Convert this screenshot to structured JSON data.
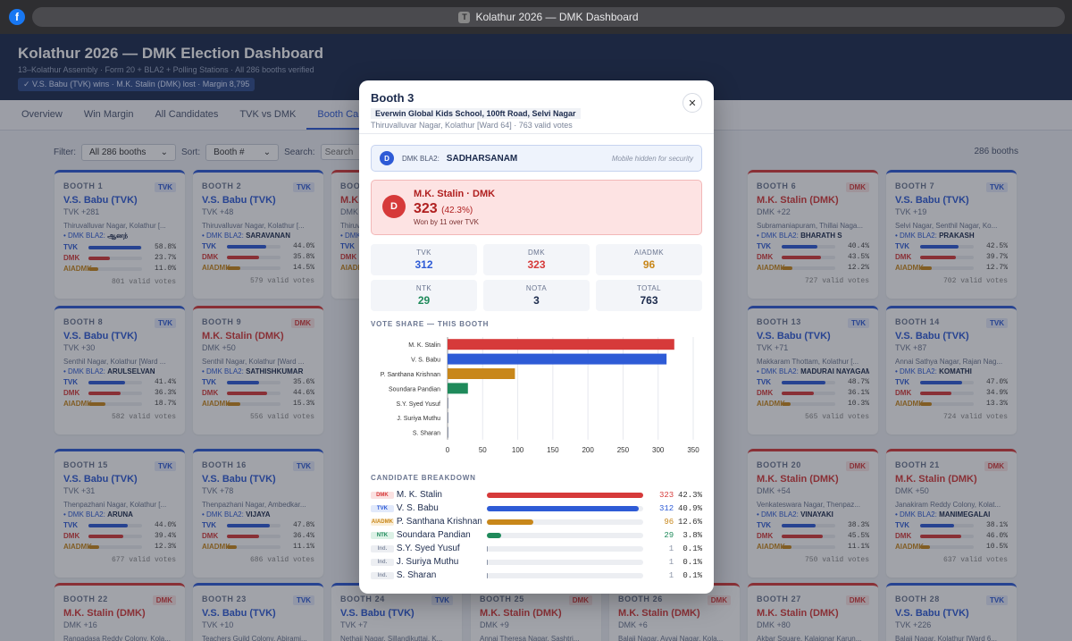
{
  "browser": {
    "fb_icon": "f",
    "tab_icon": "T",
    "title": "Kolathur 2026 — DMK Dashboard"
  },
  "header": {
    "title": "Kolathur 2026 — DMK Election Dashboard",
    "subtitle": "13–Kolathur Assembly · Form 20 + BLA2 + Polling Stations · All 286 booths verified",
    "result_badge": "✓ V.S. Babu (TVK) wins · M.K. Stalin (DMK) lost · Margin 8,795"
  },
  "tabs": [
    "Overview",
    "Win Margin",
    "All Candidates",
    "TVK vs DMK",
    "Booth Card"
  ],
  "filters": {
    "filter_label": "Filter:",
    "filter_value": "All 286 booths",
    "sort_label": "Sort:",
    "sort_value": "Booth #",
    "search_label": "Search:",
    "search_placeholder": "Search",
    "count": "286 booths"
  },
  "colors": {
    "tvk": "#2e5bd6",
    "dmk": "#d63a3a",
    "aiadmk": "#c8871a",
    "ntk": "#1f8a5b"
  },
  "cards": [
    {
      "id": "c1",
      "booth": "BOOTH 1",
      "party": "TVK",
      "winner": "V.S. Babu (TVK)",
      "margin": "TVK +281",
      "loc": "Thiruvalluvar Nagar, Kolathur [...",
      "bla_label": "DMK BLA2:",
      "bla": "ஆனந்",
      "tvk": "58.8%",
      "dmk": "23.7%",
      "aiadmk": "11.0%",
      "tvk_v": 58.8,
      "dmk_v": 23.7,
      "aiadmk_v": 11.0,
      "votes": "801 valid votes"
    },
    {
      "id": "c2",
      "booth": "BOOTH 2",
      "party": "TVK",
      "winner": "V.S. Babu (TVK)",
      "margin": "TVK +48",
      "loc": "Thiruvalluvar Nagar, Kolathur [...",
      "bla_label": "DMK BLA2:",
      "bla": "SARAVANAN",
      "tvk": "44.0%",
      "dmk": "35.8%",
      "aiadmk": "14.5%",
      "tvk_v": 44.0,
      "dmk_v": 35.8,
      "aiadmk_v": 14.5,
      "votes": "579 valid votes"
    },
    {
      "id": "c3",
      "booth": "BOOTH 3",
      "party": "DMK",
      "winner": "M.K. Stalin (DMK)",
      "margin": "DMK +11",
      "loc": "Thiruvalluvar Nagar, Kolathur [...",
      "bla_label": "DMK BLA2:",
      "bla": "SADHARSANAM",
      "tvk": "40.9%",
      "dmk": "42.3%",
      "aiadmk": "12.6%",
      "tvk_v": 40.9,
      "dmk_v": 42.3,
      "aiadmk_v": 12.6,
      "votes": "763 valid votes"
    },
    {
      "id": "c6",
      "booth": "BOOTH 6",
      "party": "DMK",
      "winner": "M.K. Stalin (DMK)",
      "margin": "DMK +22",
      "loc": "Subramaniapuram, Thillai Naga...",
      "bla_label": "DMK BLA2:",
      "bla": "BHARATH S",
      "tvk": "40.4%",
      "dmk": "43.5%",
      "aiadmk": "12.2%",
      "tvk_v": 40.4,
      "dmk_v": 43.5,
      "aiadmk_v": 12.2,
      "votes": "727 valid votes"
    },
    {
      "id": "c7",
      "booth": "BOOTH 7",
      "party": "TVK",
      "winner": "V.S. Babu (TVK)",
      "margin": "TVK +19",
      "loc": "Selvi Nagar, Senthil Nagar, Ko...",
      "bla_label": "DMK BLA2:",
      "bla": "PRAKASH",
      "tvk": "42.5%",
      "dmk": "39.7%",
      "aiadmk": "12.7%",
      "tvk_v": 42.5,
      "dmk_v": 39.7,
      "aiadmk_v": 12.7,
      "votes": "702 valid votes"
    },
    {
      "id": "c8",
      "booth": "BOOTH 8",
      "party": "TVK",
      "winner": "V.S. Babu (TVK)",
      "margin": "TVK +30",
      "loc": "Senthil Nagar, Kolathur [Ward ...",
      "bla_label": "DMK BLA2:",
      "bla": "ARULSELVAN",
      "tvk": "41.4%",
      "dmk": "36.3%",
      "aiadmk": "18.7%",
      "tvk_v": 41.4,
      "dmk_v": 36.3,
      "aiadmk_v": 18.7,
      "votes": "582 valid votes"
    },
    {
      "id": "c9",
      "booth": "BOOTH 9",
      "party": "DMK",
      "winner": "M.K. Stalin (DMK)",
      "margin": "DMK +50",
      "loc": "Senthil Nagar, Kolathur [Ward ...",
      "bla_label": "DMK BLA2:",
      "bla": "SATHISHKUMAR",
      "tvk": "35.6%",
      "dmk": "44.6%",
      "aiadmk": "15.3%",
      "tvk_v": 35.6,
      "dmk_v": 44.6,
      "aiadmk_v": 15.3,
      "votes": "556 valid votes"
    },
    {
      "id": "c13",
      "booth": "BOOTH 13",
      "party": "TVK",
      "winner": "V.S. Babu (TVK)",
      "margin": "TVK +71",
      "loc": "Makkaram Thottam, Kolathur [...",
      "bla_label": "DMK BLA2:",
      "bla": "MADURAI NAYAGAM",
      "tvk": "48.7%",
      "dmk": "36.1%",
      "aiadmk": "10.3%",
      "tvk_v": 48.7,
      "dmk_v": 36.1,
      "aiadmk_v": 10.3,
      "votes": "565 valid votes"
    },
    {
      "id": "c14",
      "booth": "BOOTH 14",
      "party": "TVK",
      "winner": "V.S. Babu (TVK)",
      "margin": "TVK +87",
      "loc": "Annai Sathya Nagar, Rajan Nag...",
      "bla_label": "DMK BLA2:",
      "bla": "KOMATHI",
      "tvk": "47.0%",
      "dmk": "34.9%",
      "aiadmk": "13.3%",
      "tvk_v": 47.0,
      "dmk_v": 34.9,
      "aiadmk_v": 13.3,
      "votes": "724 valid votes"
    },
    {
      "id": "c15",
      "booth": "BOOTH 15",
      "party": "TVK",
      "winner": "V.S. Babu (TVK)",
      "margin": "TVK +31",
      "loc": "Thenpazhani Nagar, Kolathur [...",
      "bla_label": "DMK BLA2:",
      "bla": "ARUNA",
      "tvk": "44.0%",
      "dmk": "39.4%",
      "aiadmk": "12.3%",
      "tvk_v": 44.0,
      "dmk_v": 39.4,
      "aiadmk_v": 12.3,
      "votes": "677 valid votes"
    },
    {
      "id": "c16",
      "booth": "BOOTH 16",
      "party": "TVK",
      "winner": "V.S. Babu (TVK)",
      "margin": "TVK +78",
      "loc": "Thenpazhani Nagar, Ambedkar...",
      "bla_label": "DMK BLA2:",
      "bla": "VIJAYA",
      "tvk": "47.8%",
      "dmk": "36.4%",
      "aiadmk": "11.1%",
      "tvk_v": 47.8,
      "dmk_v": 36.4,
      "aiadmk_v": 11.1,
      "votes": "686 valid votes"
    },
    {
      "id": "c20",
      "booth": "BOOTH 20",
      "party": "DMK",
      "winner": "M.K. Stalin (DMK)",
      "margin": "DMK +54",
      "loc": "Venkateswara Nagar, Thenpaz...",
      "bla_label": "DMK BLA2:",
      "bla": "VINAYAKI",
      "tvk": "38.3%",
      "dmk": "45.5%",
      "aiadmk": "11.1%",
      "tvk_v": 38.3,
      "dmk_v": 45.5,
      "aiadmk_v": 11.1,
      "votes": "750 valid votes"
    },
    {
      "id": "c21",
      "booth": "BOOTH 21",
      "party": "DMK",
      "winner": "M.K. Stalin (DMK)",
      "margin": "DMK +50",
      "loc": "Janakiram Reddy Colony, Kolat...",
      "bla_label": "DMK BLA2:",
      "bla": "MANIMEGALAI",
      "tvk": "38.1%",
      "dmk": "46.0%",
      "aiadmk": "10.5%",
      "tvk_v": 38.1,
      "dmk_v": 46.0,
      "aiadmk_v": 10.5,
      "votes": "637 valid votes"
    },
    {
      "id": "c22",
      "booth": "BOOTH 22",
      "party": "DMK",
      "winner": "M.K. Stalin (DMK)",
      "margin": "DMK +16",
      "loc": "Rangadasa Reddy Colony, Kola..."
    },
    {
      "id": "c23",
      "booth": "BOOTH 23",
      "party": "TVK",
      "winner": "V.S. Babu (TVK)",
      "margin": "TVK +10",
      "loc": "Teachers Guild Colony, Abirami..."
    },
    {
      "id": "c24",
      "booth": "BOOTH 24",
      "party": "TVK",
      "winner": "V.S. Babu (TVK)",
      "margin": "TVK +7",
      "loc": "Nethaji Nagar, Sillandikuttai, K..."
    },
    {
      "id": "c25",
      "booth": "BOOTH 25",
      "party": "DMK",
      "winner": "M.K. Stalin (DMK)",
      "margin": "DMK +9",
      "loc": "Annai Theresa Nagar, Sashtri..."
    },
    {
      "id": "c26",
      "booth": "BOOTH 26",
      "party": "DMK",
      "winner": "M.K. Stalin (DMK)",
      "margin": "DMK +6",
      "loc": "Balaji Nagar, Avvai Nagar, Kola..."
    },
    {
      "id": "c27",
      "booth": "BOOTH 27",
      "party": "DMK",
      "winner": "M.K. Stalin (DMK)",
      "margin": "DMK +80",
      "loc": "Akbar Square, Kalaignar Karun..."
    },
    {
      "id": "c28",
      "booth": "BOOTH 28",
      "party": "TVK",
      "winner": "V.S. Babu (TVK)",
      "margin": "TVK +226",
      "loc": "Balaji Nagar, Kolathur [Ward 6..."
    }
  ],
  "modal": {
    "title": "Booth 3",
    "school": "Everwin Global Kids School, 100ft Road, Selvi Nagar",
    "address": "Thiruvalluvar Nagar, Kolathur [Ward 64] · 763 valid votes",
    "close": "✕",
    "agent": {
      "icon": "D",
      "label": "DMK BLA2:",
      "name": "SADHARSANAM",
      "note": "Mobile hidden for security"
    },
    "winner": {
      "icon": "D",
      "name": "M.K. Stalin · DMK",
      "votes": "323",
      "pct": "(42.3%)",
      "margin_text": "Won by 11 over TVK"
    },
    "stats": [
      {
        "key": "TVK",
        "value": "312",
        "color": "#2e5bd6"
      },
      {
        "key": "DMK",
        "value": "323",
        "color": "#d63a3a"
      },
      {
        "key": "AIADMK",
        "value": "96",
        "color": "#c8871a"
      },
      {
        "key": "NTK",
        "value": "29",
        "color": "#1f8a5b"
      },
      {
        "key": "NOTA",
        "value": "3",
        "color": "#1b2a4c"
      },
      {
        "key": "TOTAL",
        "value": "763",
        "color": "#1b2a4c"
      }
    ],
    "vote_share_title": "VOTE SHARE — THIS BOOTH",
    "breakdown_title": "CANDIDATE BREAKDOWN",
    "breakdown": [
      {
        "party": "DMK",
        "name": "M. K. Stalin",
        "votes": "323",
        "share": "42.3%",
        "share_v": 42.3,
        "color": "#d63a3a",
        "bg": "#fbe1e1"
      },
      {
        "party": "TVK",
        "name": "V. S. Babu",
        "votes": "312",
        "share": "40.9%",
        "share_v": 40.9,
        "color": "#2e5bd6",
        "bg": "#e1e9fb"
      },
      {
        "party": "AIADMK",
        "name": "P. Santhana Krishnan",
        "votes": "96",
        "share": "12.6%",
        "share_v": 12.6,
        "color": "#c8871a",
        "bg": "#fbefd9"
      },
      {
        "party": "NTK",
        "name": "Soundara Pandian",
        "votes": "29",
        "share": "3.8%",
        "share_v": 3.8,
        "color": "#1f8a5b",
        "bg": "#dcf1e6"
      },
      {
        "party": "Ind.",
        "name": "S.Y. Syed Yusuf",
        "votes": "1",
        "share": "0.1%",
        "share_v": 0.1,
        "color": "#8a93a6",
        "bg": "#eceef2"
      },
      {
        "party": "Ind.",
        "name": "J. Suriya Muthu",
        "votes": "1",
        "share": "0.1%",
        "share_v": 0.1,
        "color": "#8a93a6",
        "bg": "#eceef2"
      },
      {
        "party": "Ind.",
        "name": "S. Sharan",
        "votes": "1",
        "share": "0.1%",
        "share_v": 0.1,
        "color": "#8a93a6",
        "bg": "#eceef2"
      }
    ]
  },
  "chart_data": {
    "type": "bar",
    "orientation": "horizontal",
    "categories": [
      "M. K. Stalin",
      "V. S. Babu",
      "P. Santhana Krishnan",
      "Soundara Pandian",
      "S.Y. Syed Yusuf",
      "J. Suriya Muthu",
      "S. Sharan"
    ],
    "values": [
      323,
      312,
      96,
      29,
      1,
      1,
      1
    ],
    "colors": [
      "#d63a3a",
      "#2e5bd6",
      "#c8871a",
      "#1f8a5b",
      "#8a93a6",
      "#8a93a6",
      "#8a93a6"
    ],
    "xticks": [
      0,
      50,
      100,
      150,
      200,
      250,
      300,
      350
    ],
    "xlim": [
      0,
      350
    ],
    "grid": true
  }
}
